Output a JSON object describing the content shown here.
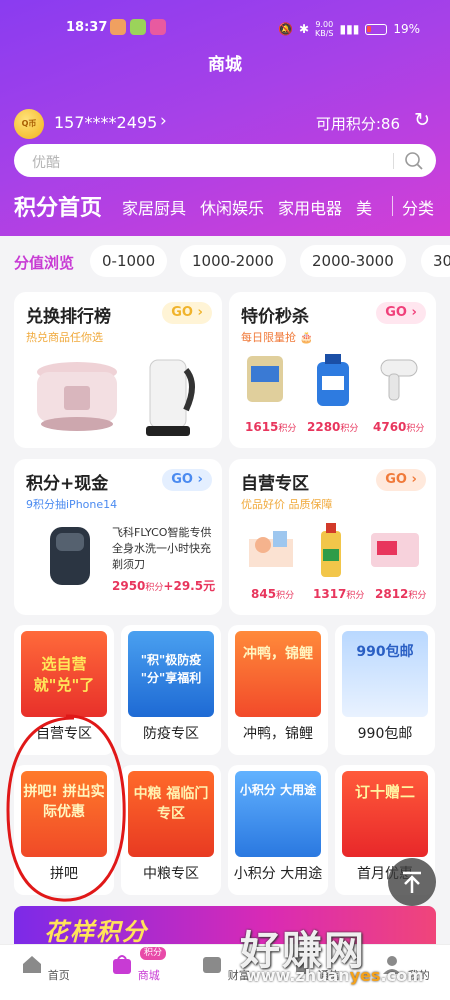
{
  "status_bar": {
    "time": "18:37",
    "speed": "9.00",
    "speed_unit": "KB/S",
    "battery": "19%"
  },
  "page": {
    "title": "商城"
  },
  "user": {
    "avatar_text": "Q币",
    "phone": "157****2495",
    "points_label": "可用积分:86"
  },
  "search": {
    "placeholder": "优酷"
  },
  "categories": {
    "active": "积分首页",
    "items": [
      "家居厨具",
      "休闲娱乐",
      "家用电器",
      "美"
    ],
    "classify": "分类"
  },
  "value_browse": {
    "label": "分值浏览",
    "chips": [
      "0-1000",
      "1000-2000",
      "2000-3000",
      "30"
    ]
  },
  "cards": {
    "ranking": {
      "title": "兑换排行榜",
      "subtitle": "热兑商品任你选",
      "go": "GO"
    },
    "flash": {
      "title": "特价秒杀",
      "subtitle": "每日限量抢",
      "go": "GO",
      "prices": [
        "1615",
        "2280",
        "4760"
      ],
      "unit": "积分"
    },
    "cash": {
      "title": "积分+现金",
      "subtitle": "9积分抽iPhone14",
      "go": "GO",
      "product_desc": "飞科FLYCO智能专供 全身水洗一小时快充剃须刀",
      "price_points": "2950",
      "unit": "积分",
      "price_cash": "+29.5元"
    },
    "self": {
      "title": "自营专区",
      "subtitle": "优品好价 品质保障",
      "go": "GO",
      "prices": [
        "845",
        "1317",
        "2812"
      ],
      "unit": "积分"
    }
  },
  "tiles": [
    {
      "label": "自营专区",
      "banner": "选自营 就\"兑\"了"
    },
    {
      "label": "防疫专区",
      "banner": "\"积\"极防疫 \"分\"享福利"
    },
    {
      "label": "冲鸭，锦鲤",
      "banner": "冲鸭，锦鲤"
    },
    {
      "label": "990包邮",
      "banner": "990包邮"
    },
    {
      "label": "拼吧",
      "banner": "拼吧! 拼出实际优惠"
    },
    {
      "label": "中粮专区",
      "banner": "中粮 福临门专区"
    },
    {
      "label": "小积分 大用途",
      "banner": "小积分 大用途"
    },
    {
      "label": "首月优惠",
      "banner": "订十赠二"
    }
  ],
  "bottom_banner": {
    "text": "花样积分"
  },
  "tabbar": {
    "items": [
      "首页",
      "商城",
      "财富",
      "通信",
      "我的"
    ],
    "badge": "积分",
    "active": 1
  },
  "watermark": {
    "text": "好赚网",
    "url_prefix": "www.zhuan",
    "url_highlight": "yes",
    "url_suffix": ".com"
  },
  "colors": {
    "accent": "#c83bd4",
    "price": "#e8365d",
    "header_start": "#8a3cf0",
    "header_end": "#d23fd6"
  }
}
